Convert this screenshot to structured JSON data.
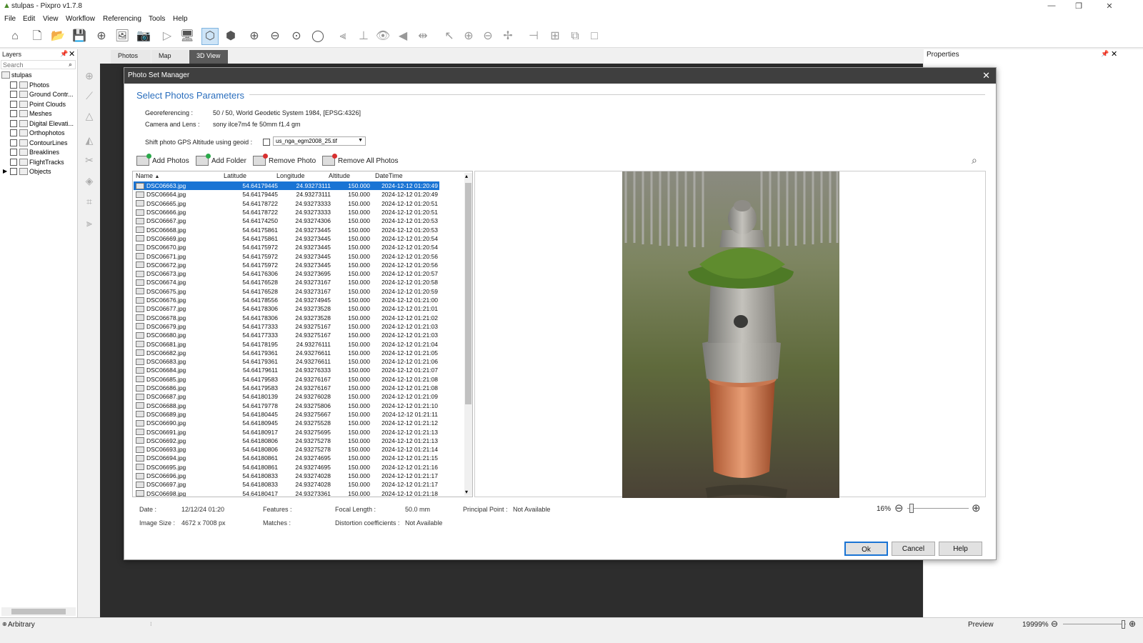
{
  "app": {
    "title": "stulpas - Pixpro v1.7.8"
  },
  "menu": [
    "File",
    "Edit",
    "View",
    "Workflow",
    "Referencing",
    "Tools",
    "Help"
  ],
  "layers": {
    "title": "Layers",
    "search_placeholder": "Search",
    "root": "stulpas",
    "items": [
      "Photos",
      "Ground Contr...",
      "Point Clouds",
      "Meshes",
      "Digital Elevati...",
      "Orthophotos",
      "ContourLines",
      "Breaklines",
      "FlightTracks",
      "Objects"
    ]
  },
  "tabs": [
    "Photos",
    "Map",
    "3D View"
  ],
  "properties": {
    "title": "Properties"
  },
  "status": {
    "left": "Arbitrary",
    "preview": "Preview",
    "zoom": "19999%"
  },
  "dialog": {
    "title": "Photo Set Manager",
    "section": "Select Photos Parameters",
    "georef_label": "Georeferencing :",
    "georef_value": "50 / 50, World Geodetic System 1984, [EPSG:4326]",
    "camera_label": "Camera and Lens :",
    "camera_value": "sony ilce7m4  fe 50mm f1.4 gm",
    "shift_label": "Shift photo GPS Altitude using geoid :",
    "geoid_value": "us_nga_egm2008_25.tif",
    "actions": {
      "add_photos": "Add Photos",
      "add_folder": "Add Folder",
      "remove_photo": "Remove Photo",
      "remove_all": "Remove All Photos"
    },
    "columns": {
      "name": "Name",
      "lat": "Latitude",
      "lon": "Longitude",
      "alt": "Altitude",
      "dt": "DateTime"
    },
    "rows": [
      [
        "DSC06663.jpg",
        "54.64179445",
        "24.93273111",
        "150.000",
        "2024-12-12 01:20:49"
      ],
      [
        "DSC06664.jpg",
        "54.64179445",
        "24.93273111",
        "150.000",
        "2024-12-12 01:20:49"
      ],
      [
        "DSC06665.jpg",
        "54.64178722",
        "24.93273333",
        "150.000",
        "2024-12-12 01:20:51"
      ],
      [
        "DSC06666.jpg",
        "54.64178722",
        "24.93273333",
        "150.000",
        "2024-12-12 01:20:51"
      ],
      [
        "DSC06667.jpg",
        "54.64174250",
        "24.93274306",
        "150.000",
        "2024-12-12 01:20:53"
      ],
      [
        "DSC06668.jpg",
        "54.64175861",
        "24.93273445",
        "150.000",
        "2024-12-12 01:20:53"
      ],
      [
        "DSC06669.jpg",
        "54.64175861",
        "24.93273445",
        "150.000",
        "2024-12-12 01:20:54"
      ],
      [
        "DSC06670.jpg",
        "54.64175972",
        "24.93273445",
        "150.000",
        "2024-12-12 01:20:54"
      ],
      [
        "DSC06671.jpg",
        "54.64175972",
        "24.93273445",
        "150.000",
        "2024-12-12 01:20:56"
      ],
      [
        "DSC06672.jpg",
        "54.64175972",
        "24.93273445",
        "150.000",
        "2024-12-12 01:20:56"
      ],
      [
        "DSC06673.jpg",
        "54.64176306",
        "24.93273695",
        "150.000",
        "2024-12-12 01:20:57"
      ],
      [
        "DSC06674.jpg",
        "54.64176528",
        "24.93273167",
        "150.000",
        "2024-12-12 01:20:58"
      ],
      [
        "DSC06675.jpg",
        "54.64176528",
        "24.93273167",
        "150.000",
        "2024-12-12 01:20:59"
      ],
      [
        "DSC06676.jpg",
        "54.64178556",
        "24.93274945",
        "150.000",
        "2024-12-12 01:21:00"
      ],
      [
        "DSC06677.jpg",
        "54.64178306",
        "24.93273528",
        "150.000",
        "2024-12-12 01:21:01"
      ],
      [
        "DSC06678.jpg",
        "54.64178306",
        "24.93273528",
        "150.000",
        "2024-12-12 01:21:02"
      ],
      [
        "DSC06679.jpg",
        "54.64177333",
        "24.93275167",
        "150.000",
        "2024-12-12 01:21:03"
      ],
      [
        "DSC06680.jpg",
        "54.64177333",
        "24.93275167",
        "150.000",
        "2024-12-12 01:21:03"
      ],
      [
        "DSC06681.jpg",
        "54.64178195",
        "24.93276111",
        "150.000",
        "2024-12-12 01:21:04"
      ],
      [
        "DSC06682.jpg",
        "54.64179361",
        "24.93276611",
        "150.000",
        "2024-12-12 01:21:05"
      ],
      [
        "DSC06683.jpg",
        "54.64179361",
        "24.93276611",
        "150.000",
        "2024-12-12 01:21:06"
      ],
      [
        "DSC06684.jpg",
        "54.64179611",
        "24.93276333",
        "150.000",
        "2024-12-12 01:21:07"
      ],
      [
        "DSC06685.jpg",
        "54.64179583",
        "24.93276167",
        "150.000",
        "2024-12-12 01:21:08"
      ],
      [
        "DSC06686.jpg",
        "54.64179583",
        "24.93276167",
        "150.000",
        "2024-12-12 01:21:08"
      ],
      [
        "DSC06687.jpg",
        "54.64180139",
        "24.93276028",
        "150.000",
        "2024-12-12 01:21:09"
      ],
      [
        "DSC06688.jpg",
        "54.64179778",
        "24.93275806",
        "150.000",
        "2024-12-12 01:21:10"
      ],
      [
        "DSC06689.jpg",
        "54.64180445",
        "24.93275667",
        "150.000",
        "2024-12-12 01:21:11"
      ],
      [
        "DSC06690.jpg",
        "54.64180945",
        "24.93275528",
        "150.000",
        "2024-12-12 01:21:12"
      ],
      [
        "DSC06691.jpg",
        "54.64180917",
        "24.93275695",
        "150.000",
        "2024-12-12 01:21:13"
      ],
      [
        "DSC06692.jpg",
        "54.64180806",
        "24.93275278",
        "150.000",
        "2024-12-12 01:21:13"
      ],
      [
        "DSC06693.jpg",
        "54.64180806",
        "24.93275278",
        "150.000",
        "2024-12-12 01:21:14"
      ],
      [
        "DSC06694.jpg",
        "54.64180861",
        "24.93274695",
        "150.000",
        "2024-12-12 01:21:15"
      ],
      [
        "DSC06695.jpg",
        "54.64180861",
        "24.93274695",
        "150.000",
        "2024-12-12 01:21:16"
      ],
      [
        "DSC06696.jpg",
        "54.64180833",
        "24.93274028",
        "150.000",
        "2024-12-12 01:21:17"
      ],
      [
        "DSC06697.jpg",
        "54.64180833",
        "24.93274028",
        "150.000",
        "2024-12-12 01:21:17"
      ],
      [
        "DSC06698.jpg",
        "54.64180417",
        "24.93273361",
        "150.000",
        "2024-12-12 01:21:18"
      ]
    ],
    "info": {
      "date_label": "Date :",
      "date_value": "12/12/24 01:20",
      "size_label": "Image Size :",
      "size_value": "4672 x 7008 px",
      "features_label": "Features :",
      "matches_label": "Matches :",
      "focal_label": "Focal Length :",
      "focal_value": "50.0 mm",
      "dist_label": "Distortion coefficients :",
      "dist_value": "Not Available",
      "pp_label": "Principal Point :",
      "pp_value": "Not Available"
    },
    "zoom": "16%",
    "zoom_level": 0.04,
    "buttons": {
      "ok": "Ok",
      "cancel": "Cancel",
      "help": "Help"
    }
  },
  "colors": {
    "selection": "#1a74d4",
    "section_title": "#2a6ebd",
    "viewport": "#2d2d2d"
  }
}
